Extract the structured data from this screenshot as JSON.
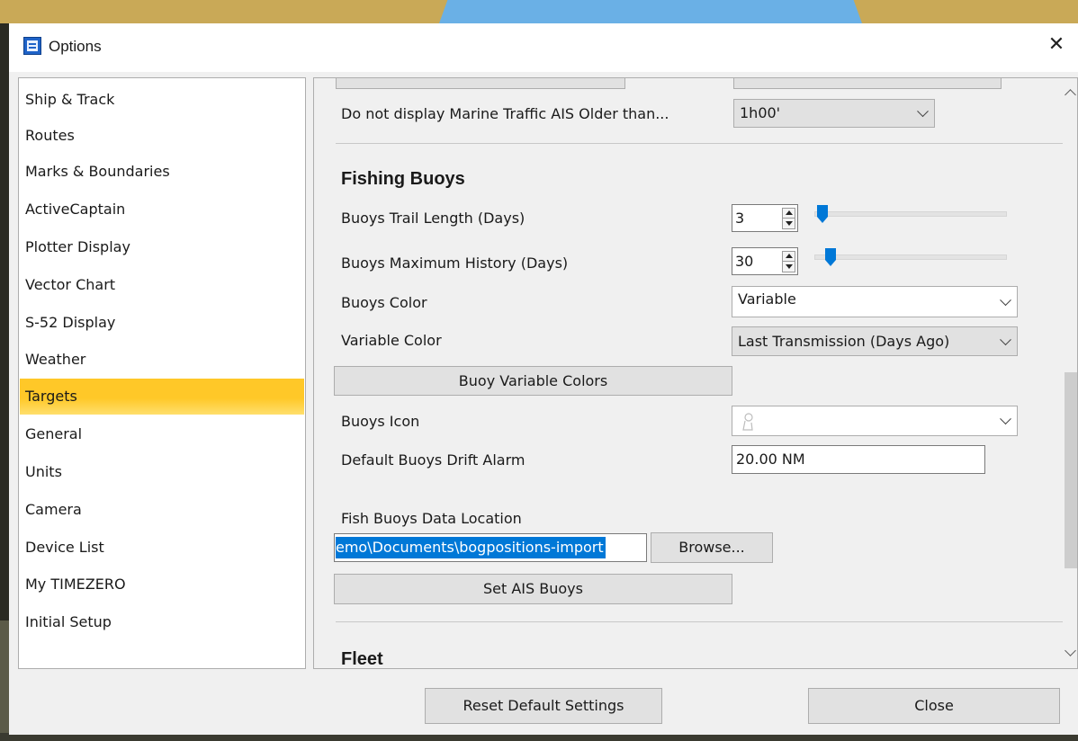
{
  "window": {
    "title": "Options",
    "close_glyph": "✕"
  },
  "nav": {
    "items": [
      {
        "label": "Ship & Track"
      },
      {
        "label": "Routes"
      },
      {
        "label": "Marks & Boundaries"
      },
      {
        "label": "ActiveCaptain"
      },
      {
        "label": "Plotter Display"
      },
      {
        "label": "Vector Chart"
      },
      {
        "label": "S-52 Display"
      },
      {
        "label": "Weather"
      },
      {
        "label": "Targets",
        "selected": true
      },
      {
        "label": "General"
      },
      {
        "label": "Units"
      },
      {
        "label": "Camera"
      },
      {
        "label": "Device List"
      },
      {
        "label": "My TIMEZERO"
      },
      {
        "label": "Initial Setup"
      }
    ],
    "selected_color": "#ffc828"
  },
  "content": {
    "marine_traffic": {
      "label": "Do not display Marine Traffic AIS Older than...",
      "value": "1h00'"
    },
    "fishing_buoys": {
      "title": "Fishing Buoys",
      "trail_length": {
        "label": "Buoys Trail Length (Days)",
        "value": "3"
      },
      "max_history": {
        "label": "Buoys Maximum History (Days)",
        "value": "30"
      },
      "color": {
        "label": "Buoys Color",
        "value": "Variable"
      },
      "variable_color": {
        "label": "Variable Color",
        "value": "Last Transmission (Days Ago)"
      },
      "variable_colors_button": "Buoy Variable Colors",
      "icon": {
        "label": "Buoys Icon",
        "icon_name": "buoy-icon"
      },
      "drift_alarm": {
        "label": "Default Buoys Drift Alarm",
        "value": "20.00 NM"
      },
      "data_location": {
        "label": "Fish Buoys Data Location",
        "value": "emo\\Documents\\bogpositions-import"
      },
      "browse_button": "Browse...",
      "set_ais_button": "Set AIS Buoys"
    },
    "fleet": {
      "title": "Fleet"
    }
  },
  "footer": {
    "reset_button": "Reset Default Settings",
    "close_button": "Close"
  },
  "colors": {
    "accent": "#0078d7",
    "selection": "#ffc828"
  }
}
